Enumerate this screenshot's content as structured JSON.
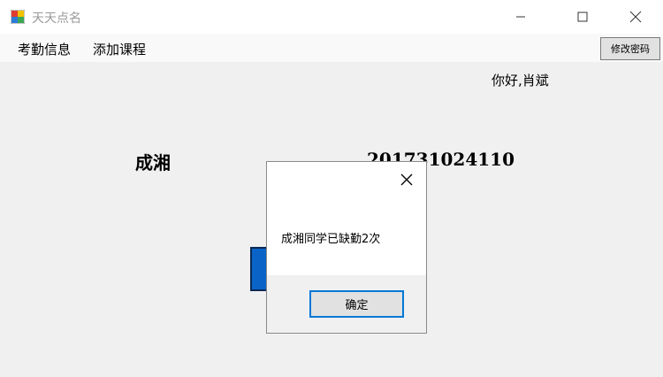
{
  "window": {
    "title": "天天点名",
    "icon": "app-icon",
    "controls": [
      "minimize-icon",
      "maximize-icon",
      "close-icon"
    ]
  },
  "menu": {
    "items": [
      {
        "label": "考勤信息"
      },
      {
        "label": "添加课程"
      }
    ]
  },
  "toolbar": {
    "change_password_label": "修改密码"
  },
  "greeting": "你好,肖斌",
  "student": {
    "name": "成湘",
    "id": "201731024110"
  },
  "dialog": {
    "message": "成湘同学已缺勤2次",
    "ok_label": "确定"
  },
  "colors": {
    "accent": "#0078d7",
    "hidden_button": "#0a64c8"
  }
}
